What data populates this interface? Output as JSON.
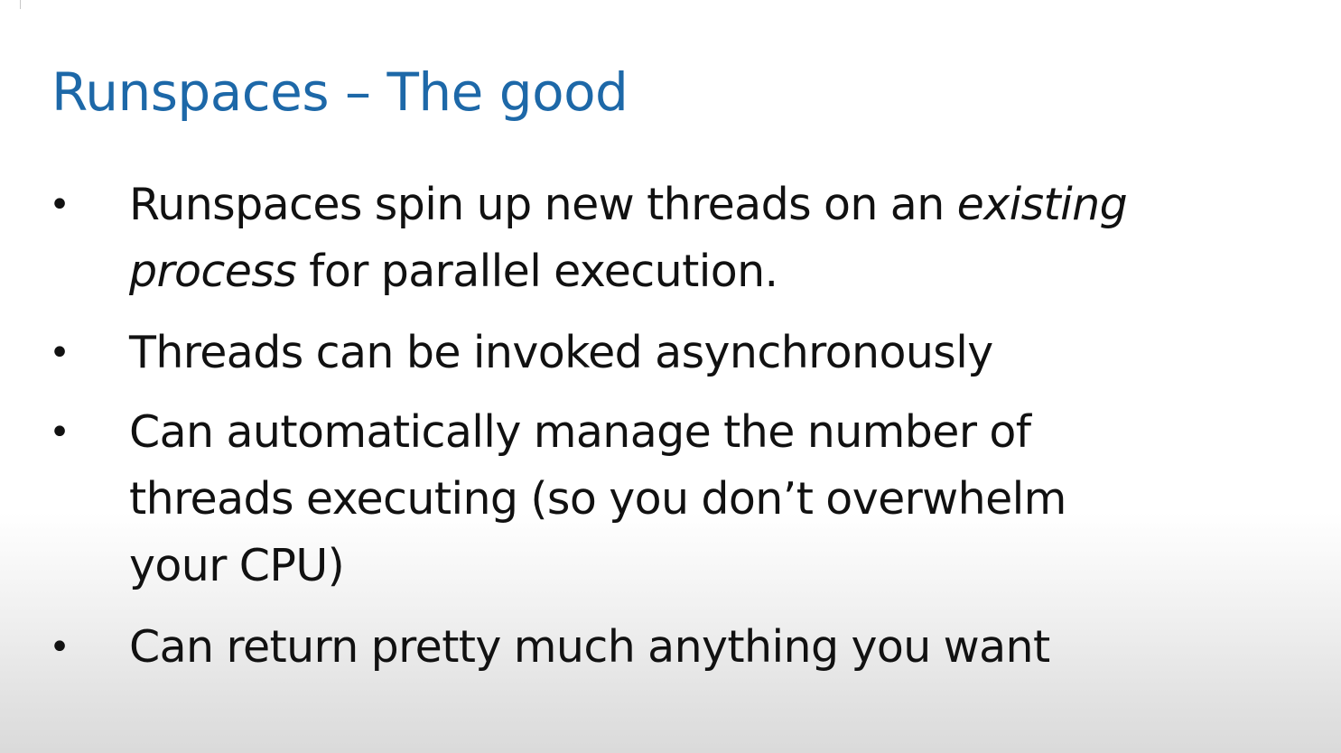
{
  "slide": {
    "title": "Runspaces – The good",
    "bullet_marker": "•",
    "bullets": [
      {
        "line1_a": "Runspaces spin up new threads on an ",
        "line1_b": "existing",
        "line2_a": "process",
        "line2_b": " for parallel execution."
      },
      {
        "line1": "Threads can be invoked asynchronously"
      },
      {
        "line1": "Can automatically manage the number of",
        "line2": "threads executing (so you don’t overwhelm",
        "line3": "your CPU)"
      },
      {
        "line1": "Can return pretty much anything you want"
      }
    ]
  },
  "colors": {
    "title": "#1d68a8",
    "body_text": "#111111",
    "background": "#ffffff"
  }
}
